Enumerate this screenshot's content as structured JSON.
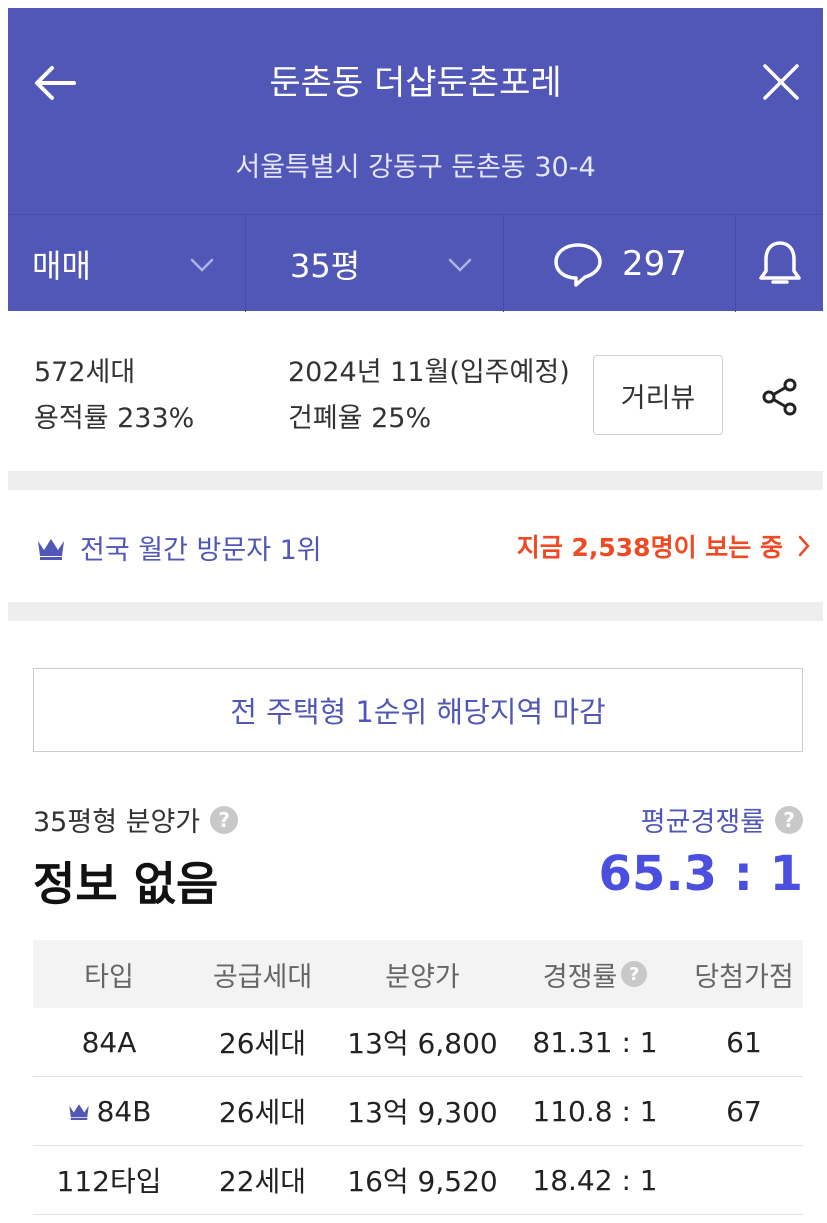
{
  "header": {
    "title": "둔촌동 더샵둔촌포레",
    "address": "서울특별시 강동구 둔촌동 30-4",
    "tabs": {
      "trade_type": "매매",
      "size": "35평",
      "comment_count": "297"
    }
  },
  "info": {
    "households": "572세대",
    "floor_area_ratio": "용적률 233%",
    "move_in": "2024년 11월(입주예정)",
    "building_coverage": "건폐율 25%",
    "street_view_button": "거리뷰"
  },
  "visitors": {
    "rank_text": "전국 월간 방문자 1위",
    "live_text": "지금 2,538명이 보는 중"
  },
  "notice": "전 주택형 1순위 해당지역 마감",
  "pricing": {
    "label": "35평형 분양가",
    "value": "정보 없음",
    "competition_label": "평균경쟁률",
    "competition_value": "65.3 : 1"
  },
  "table": {
    "headers": [
      "타입",
      "공급세대",
      "분양가",
      "경쟁률",
      "당첨가점"
    ],
    "rows": [
      [
        "84A",
        "26세대",
        "13억 6,800",
        "81.31 : 1",
        "61"
      ],
      [
        "84B",
        "26세대",
        "13억 9,300",
        "110.8 : 1",
        "67"
      ],
      [
        "112타입",
        "22세대",
        "16억 9,520",
        "18.42 : 1",
        ""
      ]
    ]
  },
  "colors": {
    "header_bg": "#5157b6",
    "accent": "#4b4fe0",
    "live_orange": "#f04a24"
  },
  "icons": [
    "back-arrow-icon",
    "close-icon",
    "chevron-down-icon",
    "speech-bubble-icon",
    "bell-icon",
    "share-icon",
    "crown-icon",
    "chevron-right-icon",
    "help-icon"
  ]
}
